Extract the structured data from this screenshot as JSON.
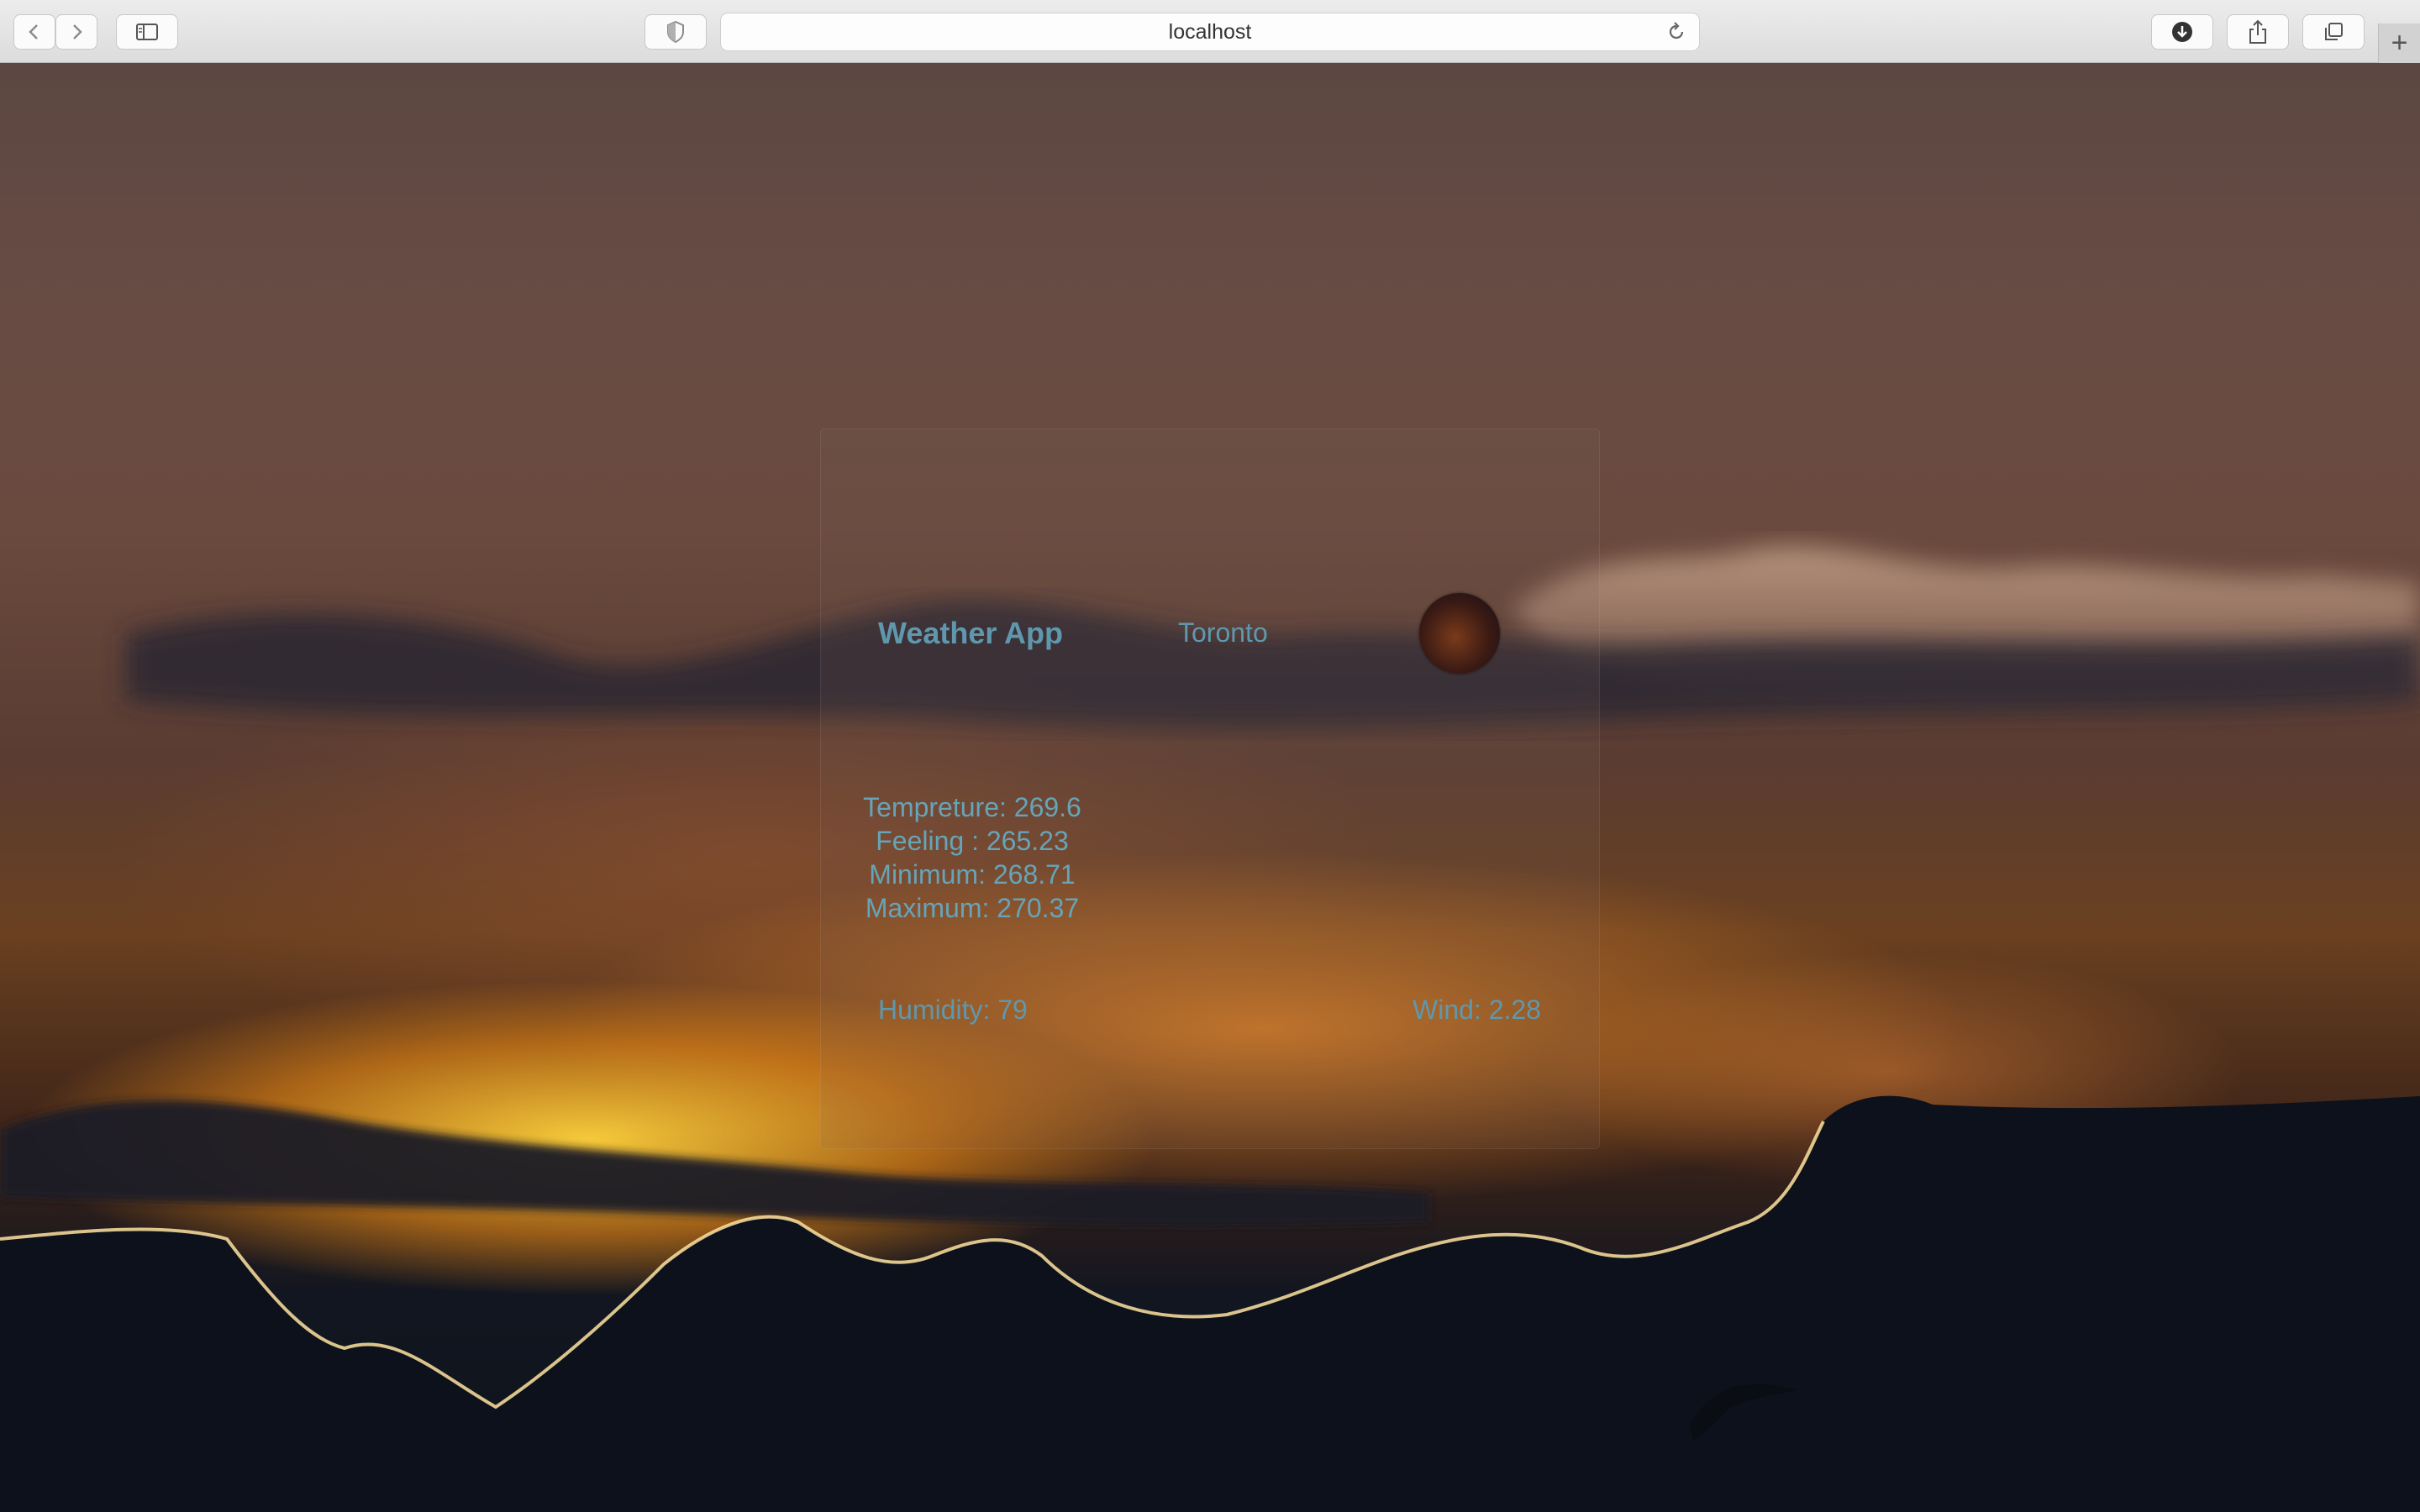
{
  "browser": {
    "url": "localhost",
    "new_tab_symbol": "+",
    "icons": {
      "back": "chevron-left-icon",
      "forward": "chevron-right-icon",
      "sidebar": "sidebar-icon",
      "privacy": "shield-icon",
      "reload": "reload-icon",
      "downloads": "download-icon",
      "share": "share-icon",
      "tabs": "tab-overview-icon"
    }
  },
  "app": {
    "title": "Weather App",
    "city": "Toronto",
    "weather_icon": "weather-icon",
    "temperature": "Tempreture: 269.6",
    "feeling": "Feeling : 265.23",
    "minimum": "Minimum: 268.71",
    "maximum": "Maximum: 270.37",
    "humidity": "Humidity: 79",
    "wind": "Wind: 2.28"
  },
  "colors": {
    "text_accent": "#5f98ad",
    "chrome_bg": "#e4e4e4"
  }
}
